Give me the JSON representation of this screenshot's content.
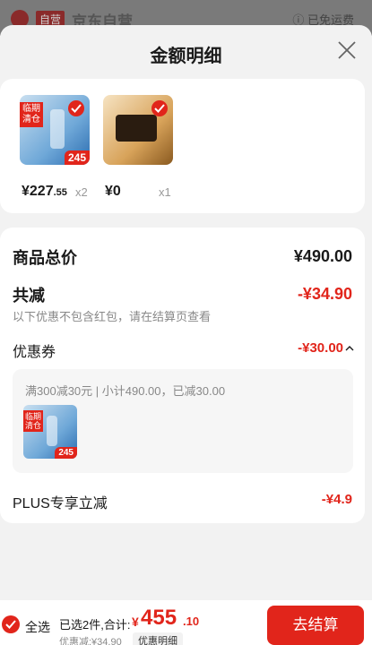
{
  "background_header": {
    "badge": "自营",
    "store": "京东自营",
    "shipping": "ⓘ 已免运费"
  },
  "sheet": {
    "title": "金额明细"
  },
  "products": [
    {
      "promo": "临期清仓",
      "price_tag": "245",
      "price_main": "¥227",
      "price_dec": ".55",
      "qty": "x2"
    },
    {
      "price_main": "¥0",
      "qty": "x1"
    }
  ],
  "summary": {
    "goods_total_label": "商品总价",
    "goods_total_value": "¥490.00",
    "total_discount_label": "共减",
    "total_discount_value": "-¥34.90",
    "note": "以下优惠不包含红包，请在结算页查看",
    "coupon_label": "优惠券",
    "coupon_value": "-¥30.00",
    "coupon_detail": "满300减30元 | 小计490.00，已减30.00",
    "coupon_thumb_promo": "临期清仓",
    "coupon_thumb_price": "245",
    "plus_label": "PLUS专享立减",
    "plus_value": "-¥4.9"
  },
  "footer": {
    "select_all": "全选",
    "selected": "已选2件,合计:",
    "yen": "¥",
    "total_main": "455",
    "total_dec": ".10",
    "discount": "优惠减:¥34.90",
    "detail": "优惠明细",
    "checkout": "去结算"
  },
  "colors": {
    "accent": "#e1251b",
    "background": "#f2f2f2"
  }
}
